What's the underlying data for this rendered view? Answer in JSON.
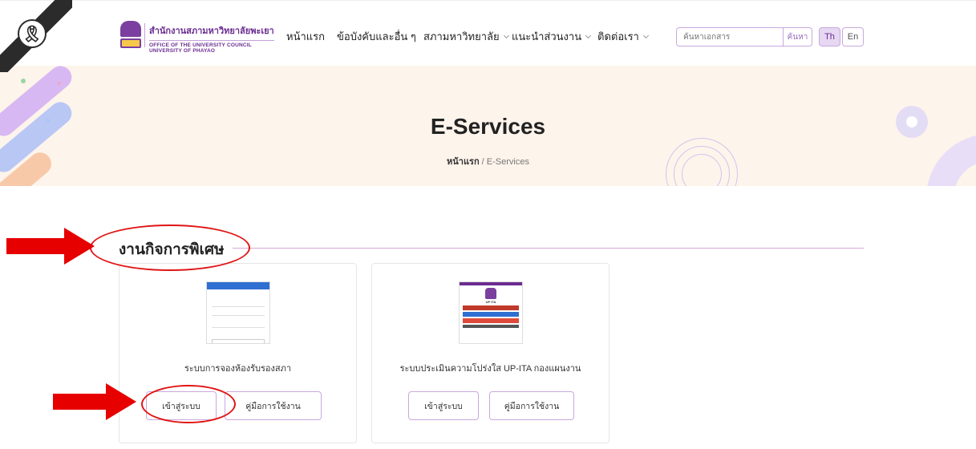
{
  "header": {
    "brand_th": "สำนักงานสภามหาวิทยาลัยพะเยา",
    "brand_en_1": "OFFICE OF THE UNIVERSITY COUNCIL",
    "brand_en_2": "UNIVERSITY OF PHAYAO",
    "nav": [
      {
        "label": "หน้าแรก",
        "has_dropdown": false
      },
      {
        "label": "ข้อบังคับและอื่น ๆ",
        "has_dropdown": false
      },
      {
        "label": "สภามหาวิทยาลัย",
        "has_dropdown": true
      },
      {
        "label": "แนะนำส่วนงาน",
        "has_dropdown": true
      },
      {
        "label": "ติดต่อเรา",
        "has_dropdown": true
      }
    ],
    "search": {
      "placeholder": "ค้นหาเอกสาร",
      "button_label": "ค้นหา"
    },
    "lang": {
      "th": "Th",
      "en": "En",
      "active": "Th"
    }
  },
  "hero": {
    "title": "E-Services",
    "breadcrumb_home": "หน้าแรก",
    "breadcrumb_sep": " / ",
    "breadcrumb_current": "E-Services"
  },
  "section": {
    "title": "งานกิจการพิเศษ"
  },
  "cards": [
    {
      "caption": "ระบบการจองห้องรับรองสภา",
      "login_label": "เข้าสู่ระบบ",
      "manual_label": "คู่มือการใช้งาน"
    },
    {
      "caption": "ระบบประเมินความโปร่งใส UP-ITA กองแผนงาน",
      "login_label": "เข้าสู่ระบบ",
      "manual_label": "คู่มือการใช้งาน",
      "thumb_title": "UP ITA"
    }
  ],
  "colors": {
    "brand_purple": "#6a2c91",
    "accent_border": "#c9a8de",
    "hero_bg": "#fdf4eb",
    "annotation_red": "#e60000"
  },
  "icons": {
    "mourning": "black-ribbon-icon",
    "dropdown": "chevron-down-icon"
  }
}
